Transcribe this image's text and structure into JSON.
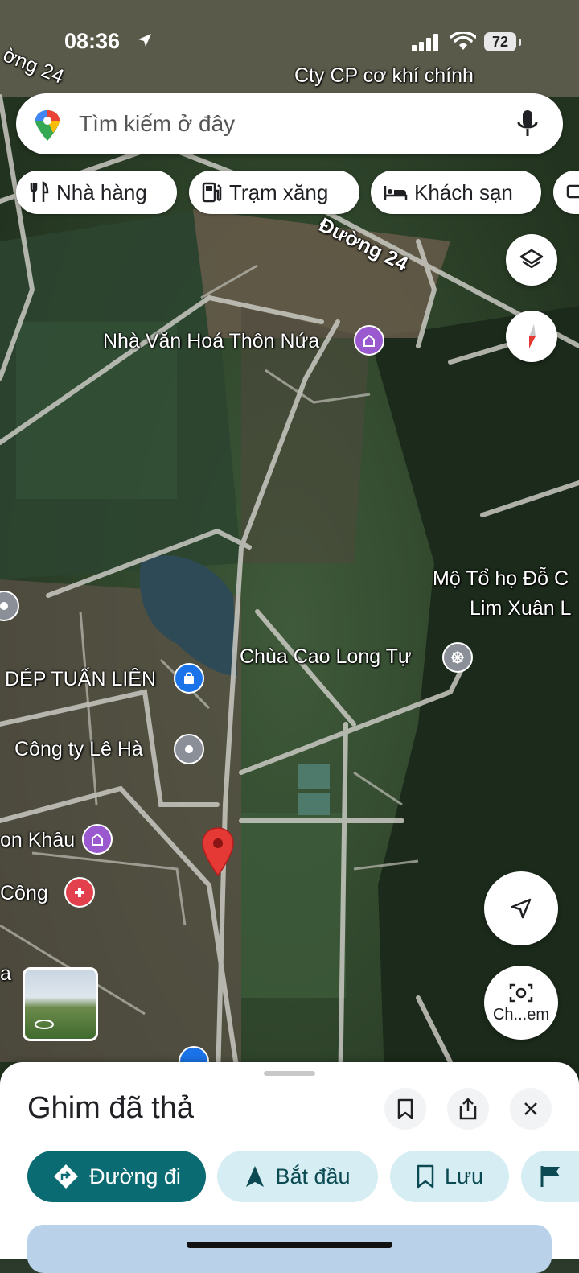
{
  "status_bar": {
    "time": "08:36",
    "battery": "72"
  },
  "search": {
    "placeholder": "Tìm kiếm ở đây"
  },
  "chips": [
    {
      "label": "Nhà hàng",
      "icon": "restaurant-icon"
    },
    {
      "label": "Trạm xăng",
      "icon": "gas-station-icon"
    },
    {
      "label": "Khách sạn",
      "icon": "hotel-icon"
    }
  ],
  "map_labels": {
    "road_top_left": "ờng 24",
    "company_top": "Cty CP cơ khí chính",
    "road_24": "Đường 24",
    "cultural_house": "Nhà Văn Hoá Thôn Nứa",
    "tomb_line1": "Mộ Tổ họ Đỗ C",
    "tomb_line2": "Lim Xuân L",
    "pagoda": "Chùa Cao Long Tự",
    "shoe_shop": "DÉP TUẤN LIÊN",
    "company_le_ha": "Công ty Lê Hà",
    "khau": "on Khâu",
    "cong": "Công",
    "edge_a": "a"
  },
  "fab": {
    "street_view_label": "Ch...em"
  },
  "sheet": {
    "title": "Ghim đã thả",
    "actions": [
      {
        "label": "Đường đi",
        "icon": "directions-icon"
      },
      {
        "label": "Bắt đầu",
        "icon": "navigation-arrow-icon"
      },
      {
        "label": "Lưu",
        "icon": "bookmark-icon"
      }
    ]
  },
  "colors": {
    "primary_action": "#0b6b73",
    "secondary_action_bg": "#d6eef3",
    "pin": "#e53935",
    "poi_purple": "#9b59d0",
    "poi_blue": "#1a73e8",
    "poi_gray": "#8a8f98",
    "poi_red": "#e2404c"
  }
}
